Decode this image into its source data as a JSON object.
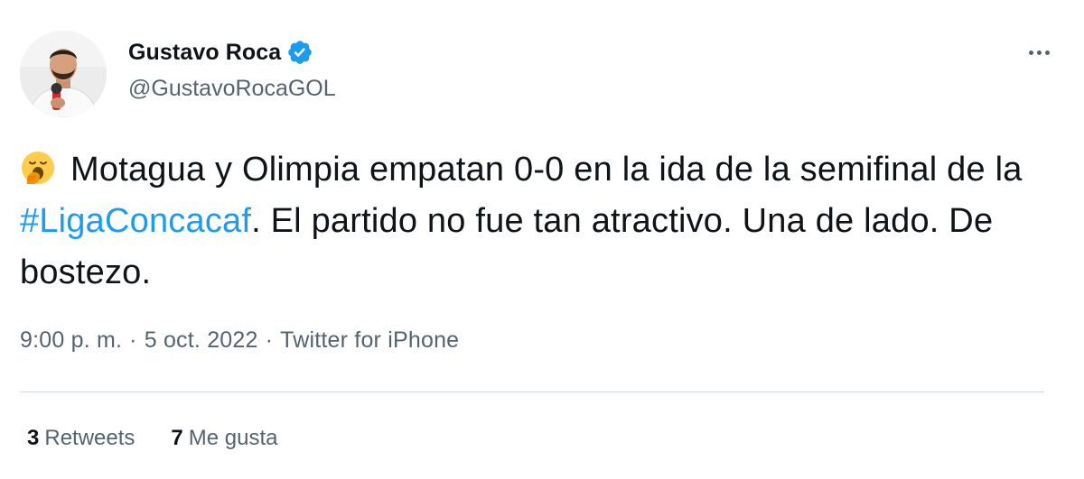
{
  "author": {
    "display_name": "Gustavo Roca",
    "handle": "@GustavoRocaGOL",
    "verified": true,
    "avatar_icon": "profile-photo"
  },
  "tweet": {
    "emoji_icon": "yawning-face-emoji",
    "text_part1": "Motagua y Olimpia empatan 0-0 en la ida de la semifinal de la ",
    "hashtag": "#LigaConcacaf",
    "text_part2": ". El partido no fue tan atractivo. Una de lado. De bostezo."
  },
  "meta": {
    "time": "9:00 p. m.",
    "separator": "·",
    "date": "5 oct. 2022",
    "source": "Twitter for iPhone"
  },
  "stats": {
    "retweets_count": "3",
    "retweets_label": "Retweets",
    "likes_count": "7",
    "likes_label": "Me gusta"
  },
  "colors": {
    "accent": "#1d9bf0",
    "secondary_text": "#536471",
    "primary_text": "#0f1419",
    "divider": "#cfd9de"
  }
}
